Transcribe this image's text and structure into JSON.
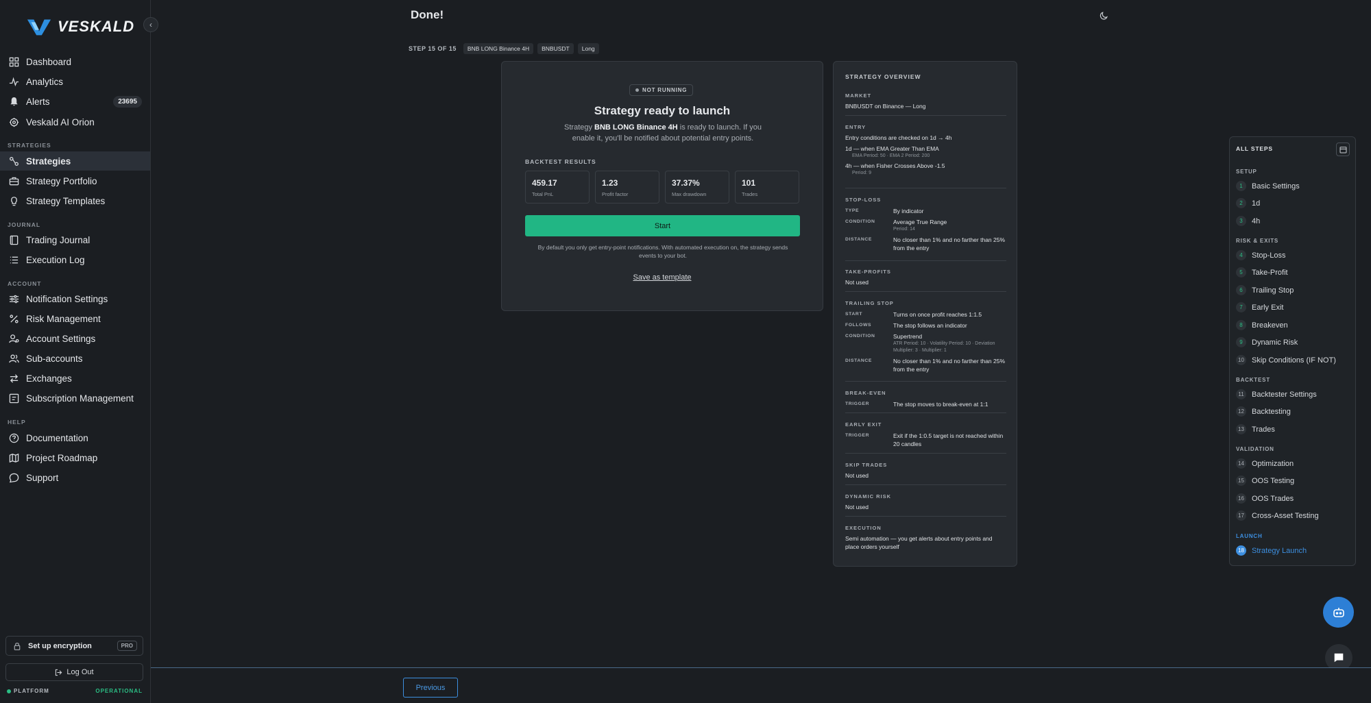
{
  "brand": {
    "name": "VESKALD"
  },
  "nav": {
    "main": [
      {
        "label": "Dashboard",
        "icon": "dashboard-icon"
      },
      {
        "label": "Analytics",
        "icon": "analytics-icon"
      },
      {
        "label": "Alerts",
        "icon": "bell-icon",
        "badge": "23695"
      },
      {
        "label": "Veskald AI Orion",
        "icon": "ai-icon"
      }
    ],
    "strategies_label": "STRATEGIES",
    "strategies": [
      {
        "label": "Strategies",
        "icon": "strategies-icon",
        "active": true
      },
      {
        "label": "Strategy Portfolio",
        "icon": "briefcase-icon"
      },
      {
        "label": "Strategy Templates",
        "icon": "lightbulb-icon"
      }
    ],
    "journal_label": "JOURNAL",
    "journal": [
      {
        "label": "Trading Journal",
        "icon": "book-icon"
      },
      {
        "label": "Execution Log",
        "icon": "list-icon"
      }
    ],
    "account_label": "ACCOUNT",
    "account": [
      {
        "label": "Notification Settings",
        "icon": "sliders-icon"
      },
      {
        "label": "Risk Management",
        "icon": "percent-icon"
      },
      {
        "label": "Account Settings",
        "icon": "user-gear-icon"
      },
      {
        "label": "Sub-accounts",
        "icon": "users-icon"
      },
      {
        "label": "Exchanges",
        "icon": "exchange-icon"
      },
      {
        "label": "Subscription Management",
        "icon": "subscription-icon"
      }
    ],
    "help_label": "HELP",
    "help": [
      {
        "label": "Documentation",
        "icon": "question-icon"
      },
      {
        "label": "Project Roadmap",
        "icon": "map-icon"
      },
      {
        "label": "Support",
        "icon": "chat-icon"
      }
    ]
  },
  "encryption": {
    "label": "Set up encryption",
    "badge": "PRO"
  },
  "logout": "Log Out",
  "platform_status": {
    "label": "PLATFORM",
    "state": "OPERATIONAL"
  },
  "header": {
    "title": "Done!"
  },
  "step_bar": {
    "text": "STEP 15 OF 15",
    "chips": [
      "BNB LONG Binance 4H",
      "BNBUSDT",
      "Long"
    ]
  },
  "launch_card": {
    "status": "NOT RUNNING",
    "title": "Strategy ready to launch",
    "desc_prefix": "Strategy ",
    "strategy_name": "BNB LONG Binance 4H",
    "desc_suffix": " is ready to launch. If you enable it, you'll be notified about potential entry points.",
    "backtest_label": "BACKTEST RESULTS",
    "metrics": [
      {
        "value": "459.17",
        "label": "Total PnL"
      },
      {
        "value": "1.23",
        "label": "Profit factor"
      },
      {
        "value": "37.37%",
        "label": "Max drawdown"
      },
      {
        "value": "101",
        "label": "Trades"
      }
    ],
    "start_label": "Start",
    "note": "By default you only get entry-point notifications. With automated execution on, the strategy sends events to your bot.",
    "template_link": "Save as template"
  },
  "overview": {
    "title": "STRATEGY OVERVIEW",
    "market": {
      "h": "MARKET",
      "t": "BNBUSDT on Binance — Long"
    },
    "entry": {
      "h": "ENTRY",
      "l1": "Entry conditions are checked on 1d → 4h",
      "l2": "1d — when EMA Greater Than EMA",
      "l2s": "EMA Period: 50 · EMA 2 Period: 200",
      "l3": "4h — when Fisher Crosses Above -1.5",
      "l3s": "Period: 9"
    },
    "stop_loss": {
      "h": "STOP-LOSS",
      "type_k": "TYPE",
      "type_v": "By indicator",
      "cond_k": "CONDITION",
      "cond_v": "Average True Range",
      "cond_s": "Period: 14",
      "dist_k": "DISTANCE",
      "dist_v": "No closer than 1% and no farther than 25% from the entry"
    },
    "take_profits": {
      "h": "TAKE-PROFITS",
      "t": "Not used"
    },
    "trailing": {
      "h": "TRAILING STOP",
      "start_k": "START",
      "start_v": "Turns on once profit reaches 1:1.5",
      "follows_k": "FOLLOWS",
      "follows_v": "The stop follows an indicator",
      "cond_k": "CONDITION",
      "cond_v": "Supertrend",
      "cond_s": "ATR Period: 10 · Volatility Period: 10 · Deviation Multiplier: 3 · Multiplier: 1",
      "dist_k": "DISTANCE",
      "dist_v": "No closer than 1% and no farther than 25% from the entry"
    },
    "break_even": {
      "h": "BREAK-EVEN",
      "k": "TRIGGER",
      "v": "The stop moves to break-even at 1:1"
    },
    "early_exit": {
      "h": "EARLY EXIT",
      "k": "TRIGGER",
      "v": "Exit if the 1:0.5 target is not reached within 20 candles"
    },
    "skip_trades": {
      "h": "SKIP TRADES",
      "t": "Not used"
    },
    "dynamic_risk": {
      "h": "DYNAMIC RISK",
      "t": "Not used"
    },
    "execution": {
      "h": "EXECUTION",
      "t": "Semi automation — you get alerts about entry points and place orders yourself"
    }
  },
  "steps_panel": {
    "title": "ALL STEPS",
    "sections": {
      "setup": "SETUP",
      "risk": "RISK & EXITS",
      "backtest": "BACKTEST",
      "validation": "VALIDATION",
      "launch": "LAUNCH"
    },
    "items": [
      {
        "n": "1",
        "label": "Basic Settings"
      },
      {
        "n": "2",
        "label": "1d"
      },
      {
        "n": "3",
        "label": "4h"
      },
      {
        "n": "4",
        "label": "Stop-Loss"
      },
      {
        "n": "5",
        "label": "Take-Profit"
      },
      {
        "n": "6",
        "label": "Trailing Stop"
      },
      {
        "n": "7",
        "label": "Early Exit"
      },
      {
        "n": "8",
        "label": "Breakeven"
      },
      {
        "n": "9",
        "label": "Dynamic Risk"
      },
      {
        "n": "10",
        "label": "Skip Conditions (IF NOT)"
      },
      {
        "n": "11",
        "label": "Backtester Settings"
      },
      {
        "n": "12",
        "label": "Backtesting"
      },
      {
        "n": "13",
        "label": "Trades"
      },
      {
        "n": "14",
        "label": "Optimization"
      },
      {
        "n": "15",
        "label": "OOS Testing"
      },
      {
        "n": "16",
        "label": "OOS Trades"
      },
      {
        "n": "17",
        "label": "Cross-Asset Testing"
      },
      {
        "n": "18",
        "label": "Strategy Launch"
      }
    ]
  },
  "footer": {
    "previous": "Previous"
  }
}
